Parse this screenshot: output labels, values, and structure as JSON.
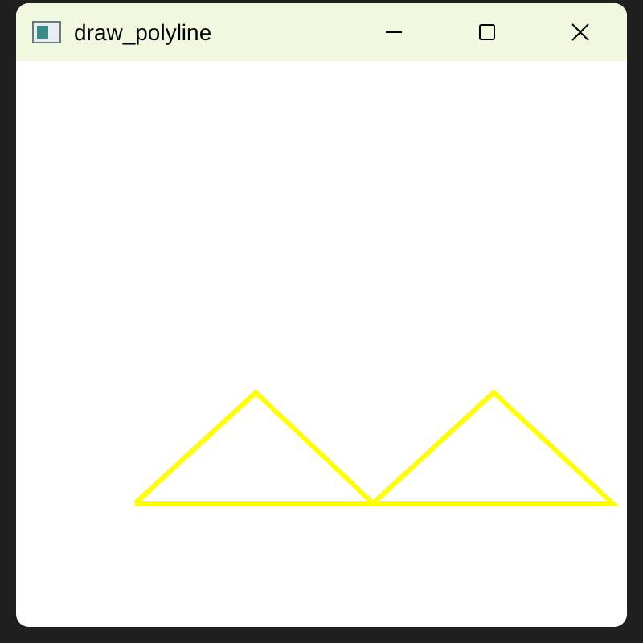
{
  "window": {
    "title": "draw_polyline"
  }
}
